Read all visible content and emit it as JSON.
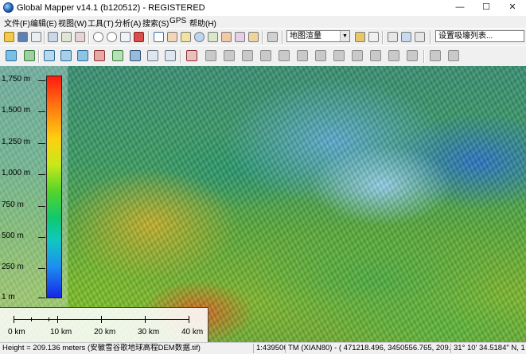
{
  "window": {
    "title": "Global Mapper v14.1 (b120512) - REGISTERED",
    "minimize": "—",
    "maximize": "☐",
    "close": "✕"
  },
  "menu": {
    "items": [
      "文件(F)",
      "编辑(E)",
      "视图(W)",
      "工具(T)",
      "分析(A)",
      "搜索(S)",
      "GPS",
      "帮助(H)"
    ]
  },
  "toolbar": {
    "shader_select": "地图渲量",
    "feature_select": "设置吸壕列表..."
  },
  "legend": {
    "labels": [
      "1,750 m",
      "1,500 m",
      "1,250 m",
      "1,000 m",
      "750 m",
      "500 m",
      "250 m",
      "1 m"
    ]
  },
  "scale_bar": {
    "labels": [
      "0 km",
      "10 km",
      "20 km",
      "30 km",
      "40 km"
    ]
  },
  "status": {
    "height": "Height = 209.136 meters (安徽雪谷歌地球高程DEM数据.tif)",
    "scale": "1:439500",
    "projection": "TM (XIAN80) - ( 471218.496, 3450556.765, 209.136 m )",
    "coords": "31° 10' 34.5184\" N, 1"
  },
  "colors": {
    "legend_top": "#ff1a0f",
    "legend_bottom": "#1526e6"
  }
}
